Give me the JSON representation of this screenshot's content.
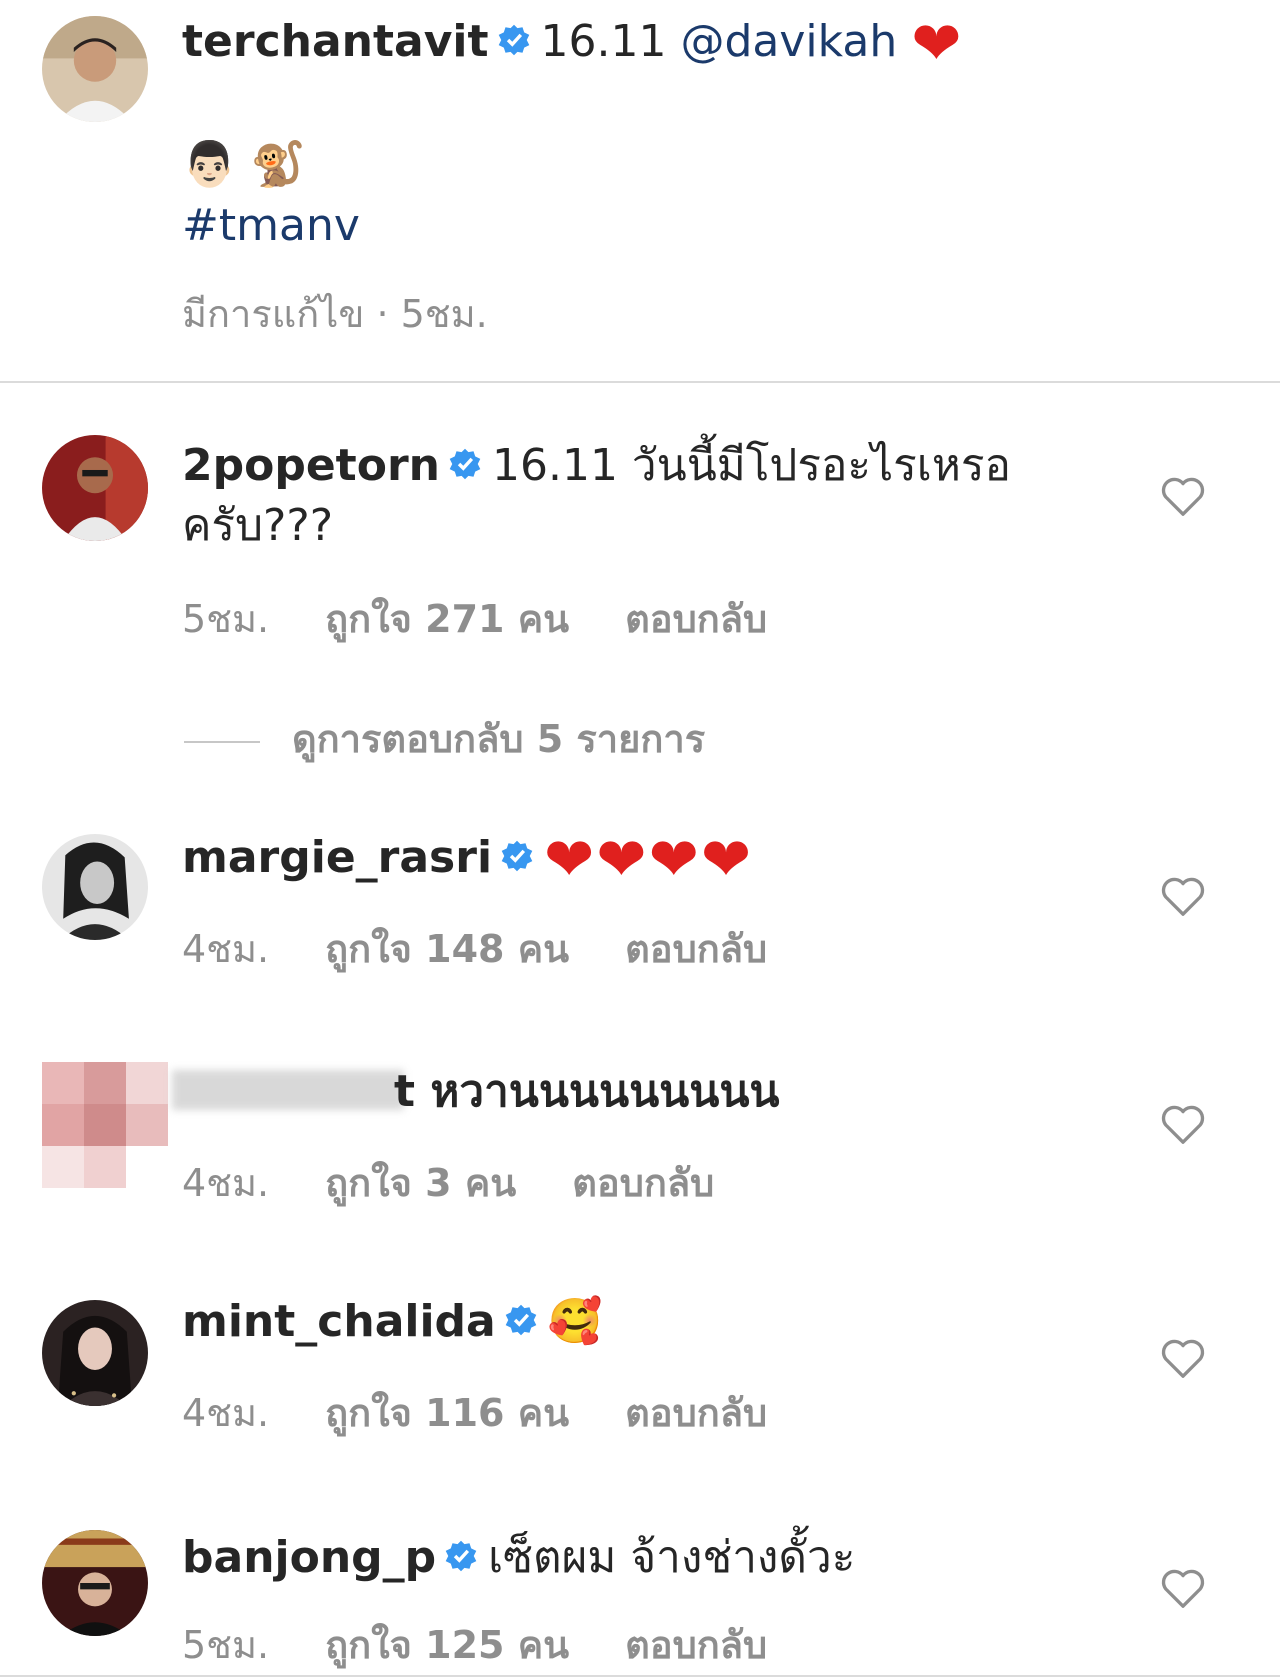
{
  "post": {
    "username": "terchantavit",
    "caption": "16.11",
    "mention": "@davikah",
    "emojis": "👨🏻 🐒",
    "hashtag": "#tmanv",
    "meta": "มีการแก้ไข · 5ชม."
  },
  "comments": [
    {
      "username": "2popetorn",
      "text_line1": "16.11 วันนี้มีโปรอะไรเหรอ",
      "text_line2": "ครับ???",
      "time": "5ชม.",
      "likes": "ถูกใจ 271 คน",
      "reply": "ตอบกลับ"
    },
    {
      "username": "margie_rasri",
      "text": "❤❤❤❤",
      "time": "4ชม.",
      "likes": "ถูกใจ 148 คน",
      "reply": "ตอบกลับ"
    },
    {
      "username": "",
      "text": "t หวานนนนนนนนน",
      "time": "4ชม.",
      "likes": "ถูกใจ 3 คน",
      "reply": "ตอบกลับ"
    },
    {
      "username": "mint_chalida",
      "text": "🥰",
      "time": "4ชม.",
      "likes": "ถูกใจ 116 คน",
      "reply": "ตอบกลับ"
    },
    {
      "username": "banjong_p",
      "text": "เซ็ตผม จ้างช่างดั้วะ",
      "time": "5ชม.",
      "likes": "ถูกใจ 125 คน",
      "reply": "ตอบกลับ"
    }
  ],
  "view_replies": "ดูการตอบกลับ 5 รายการ",
  "colors": {
    "text": "#262626",
    "meta": "#8e8e8e",
    "link": "#1b3a6b",
    "verified": "#3897f0",
    "heart": "#e0201e"
  },
  "icons": {
    "verified": "verified-badge-icon",
    "like": "heart-outline-icon"
  }
}
